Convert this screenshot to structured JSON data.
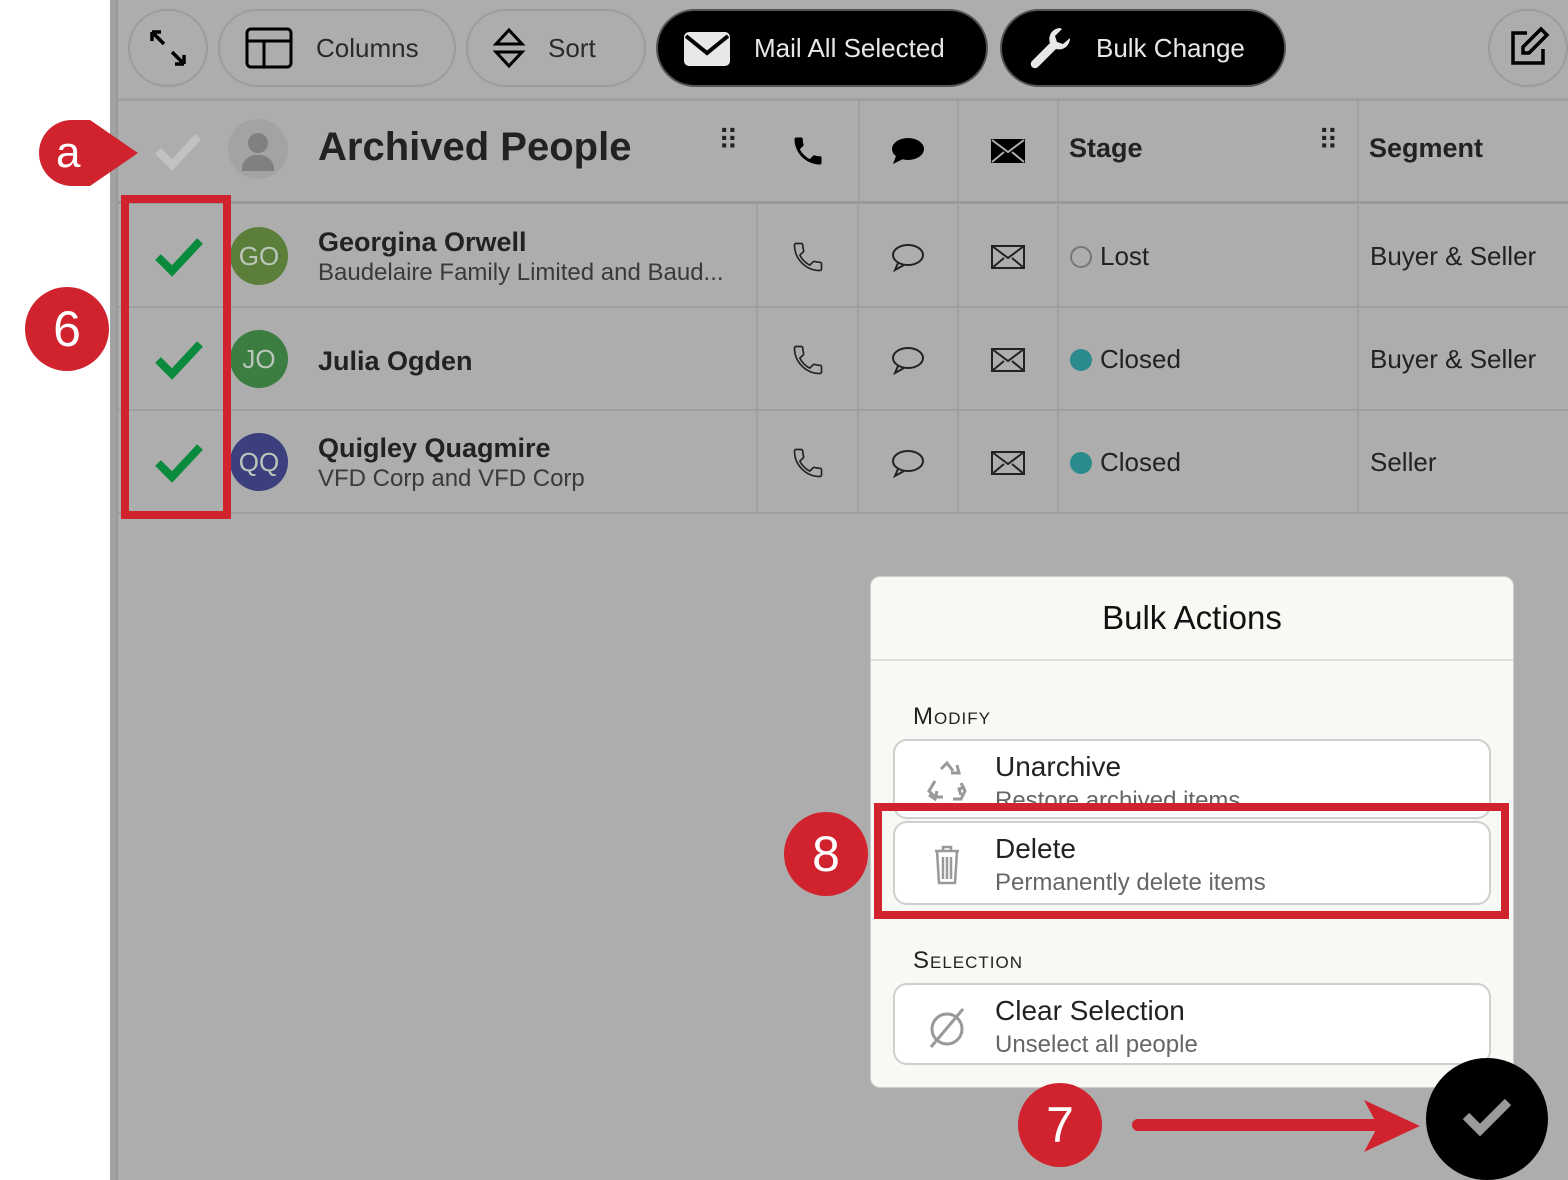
{
  "toolbar": {
    "columns_label": "Columns",
    "sort_label": "Sort",
    "mail_label": "Mail All Selected",
    "bulk_label": "Bulk Change"
  },
  "table": {
    "title": "Archived People",
    "headers": {
      "stage": "Stage",
      "segment": "Segment"
    },
    "rows": [
      {
        "initials": "GO",
        "name": "Georgina Orwell",
        "company": "Baudelaire Family Limited and Baud...",
        "stage": "Lost",
        "segment": "Buyer & Seller",
        "avatar_color": "#5b7f3b",
        "stage_color": "none"
      },
      {
        "initials": "JO",
        "name": "Julia Ogden",
        "company": "",
        "stage": "Closed",
        "segment": "Buyer & Seller",
        "avatar_color": "#3c7d42",
        "stage_color": "#2a8a8c"
      },
      {
        "initials": "QQ",
        "name": "Quigley Quagmire",
        "company": "VFD Corp and VFD Corp",
        "stage": "Closed",
        "segment": "Seller",
        "avatar_color": "#3b3f7d",
        "stage_color": "#2a8a8c"
      }
    ]
  },
  "bulk_actions": {
    "title": "Bulk Actions",
    "modify_label": "Modify",
    "selection_label": "Selection",
    "unarchive": {
      "title": "Unarchive",
      "desc": "Restore archived items"
    },
    "delete": {
      "title": "Delete",
      "desc": "Permanently delete items"
    },
    "clear": {
      "title": "Clear Selection",
      "desc": "Unselect all people"
    }
  },
  "annotations": {
    "a": "a",
    "six": "6",
    "seven": "7",
    "eight": "8"
  },
  "colors": {
    "annotation_red": "#d0232e",
    "check_green": "#0a8a3c"
  }
}
